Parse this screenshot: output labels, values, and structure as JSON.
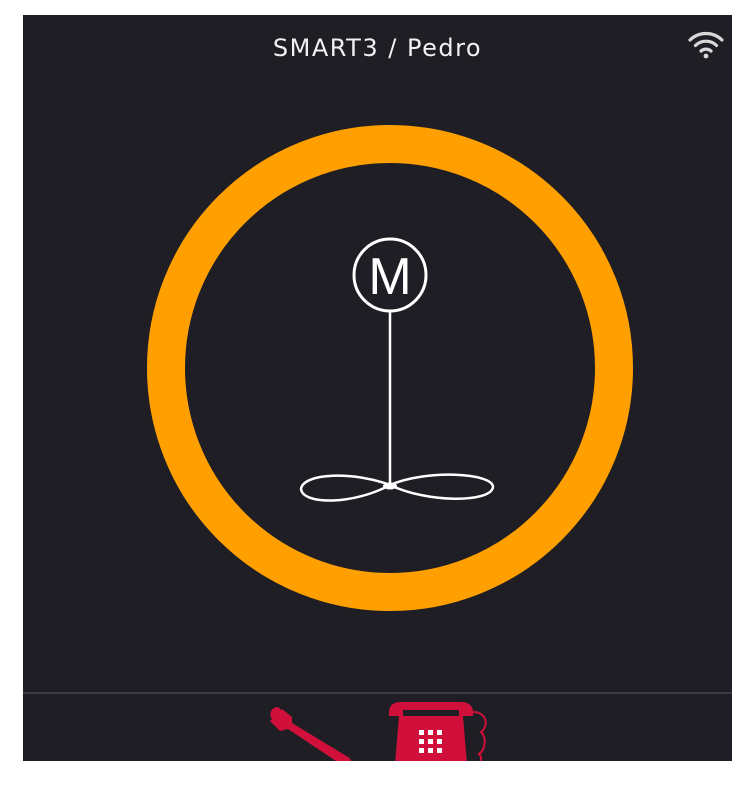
{
  "header": {
    "title": "SMART3 / Pedro",
    "wifi_icon": "wifi-icon"
  },
  "dial": {
    "mode_letter": "M",
    "ring_color": "#ffa000",
    "icon": "mixer-motor-icon"
  },
  "toolbar": {
    "settings_icon": "wrench-icon",
    "phone_icon": "telephone-icon",
    "accent_color": "#d0103a"
  }
}
